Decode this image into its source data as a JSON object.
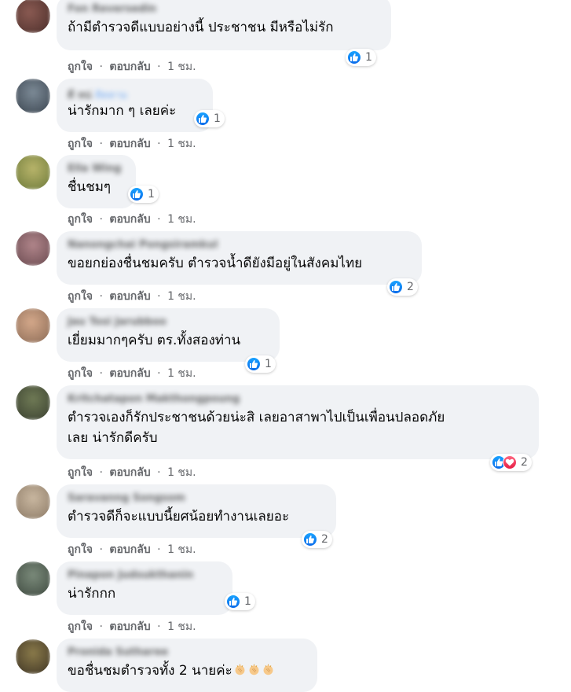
{
  "actions": {
    "like": "ถูกใจ",
    "reply": "ตอบกลับ",
    "sep": "·",
    "time": "1 ชม."
  },
  "colors": {
    "bubble": "#f0f2f5",
    "like": "#1877f2",
    "love": "#f33e58",
    "meta": "#65676b"
  },
  "comments": [
    {
      "name": "Fon Reversedin",
      "text": "ถ้ามีตำรวจดีแบบอย่างนี้ ประชาชน มีหรือไม่รัก",
      "reactions": "1"
    },
    {
      "name": "ดี หน่",
      "tag": "ติดตาม",
      "text": "น่ารักมาก ๆ เลยค่ะ",
      "reactions": "1"
    },
    {
      "name": "Ella Wing",
      "text": "ชื่นชมๆ",
      "reactions": "1"
    },
    {
      "name": "Nanongchai Pongsiramkul",
      "text": "ขอยกย่องชื่นชมครับ ตำรวจน้ำดียังมีอยู่ในสังคมไทย",
      "reactions": "2"
    },
    {
      "name": "Jau Tosi Jarubboo",
      "text": "เยี่ยมมากๆครับ ตร.ทั้งสองท่าน",
      "reactions": "1"
    },
    {
      "name": "Kritchatapon Makthongpoung",
      "text_line1": "ตำรวจเองก็รักประชาชนด้วยน่ะสิ เลยอาสาพาไปเป็นเพื่อนปลอดภัย",
      "text_line2": "เลย น่ารักดีครับ",
      "reactions": "2"
    },
    {
      "name": "Saravanng Songsom",
      "text": "ตำรวจดีก็จะแบบนี้ยศน้อยทำงานเลยอะ",
      "reactions": "2"
    },
    {
      "name": "Pinapon Judsukthanin",
      "text": "น่ารักกก",
      "reactions": "1"
    },
    {
      "name": "Pronida Sutharee",
      "text": "ขอชื่นชมตำรวจทั้ง 2 นายค่ะ",
      "emoji": "clapping-hands"
    }
  ]
}
